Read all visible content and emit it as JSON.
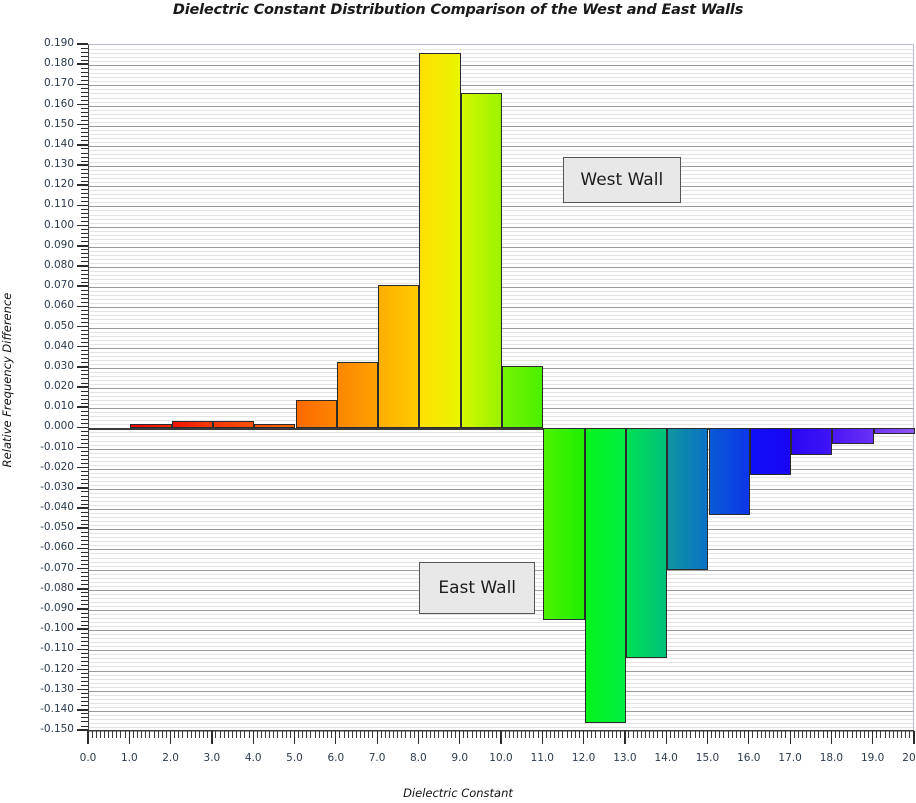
{
  "chart_data": {
    "type": "bar",
    "title": "Dielectric Constant Distribution Comparison of the West and East Walls",
    "xlabel": "Dielectric Constant",
    "ylabel": "Relative Frequency Difference",
    "xlim": [
      0.0,
      20.0
    ],
    "ylim": [
      -0.15,
      0.19
    ],
    "grid": true,
    "legend_position": "inside-annotations",
    "x_tick_labels": [
      "0.0",
      "1.0",
      "2.0",
      "3.0",
      "4.0",
      "5.0",
      "6.0",
      "7.0",
      "8.0",
      "9.0",
      "10.0",
      "11.0",
      "12.0",
      "13.0",
      "14.0",
      "15.0",
      "16.0",
      "17.0",
      "18.0",
      "19.0",
      "20.0"
    ],
    "x_tick_values": [
      0,
      1,
      2,
      3,
      4,
      5,
      6,
      7,
      8,
      9,
      10,
      11,
      12,
      13,
      14,
      15,
      16,
      17,
      18,
      19,
      20
    ],
    "y_tick_labels": [
      "0.190",
      "0.180",
      "0.170",
      "0.160",
      "0.150",
      "0.140",
      "0.130",
      "0.120",
      "0.110",
      "0.100",
      "0.090",
      "0.080",
      "0.070",
      "0.060",
      "0.050",
      "0.040",
      "0.030",
      "0.020",
      "0.010",
      "0.000",
      "-0.010",
      "-0.020",
      "-0.030",
      "-0.040",
      "-0.050",
      "-0.060",
      "-0.070",
      "-0.080",
      "-0.090",
      "-0.100",
      "-0.110",
      "-0.120",
      "-0.130",
      "-0.140",
      "-0.150"
    ],
    "y_tick_values": [
      0.19,
      0.18,
      0.17,
      0.16,
      0.15,
      0.14,
      0.13,
      0.12,
      0.11,
      0.1,
      0.09,
      0.08,
      0.07,
      0.06,
      0.05,
      0.04,
      0.03,
      0.02,
      0.01,
      0.0,
      -0.01,
      -0.02,
      -0.03,
      -0.04,
      -0.05,
      -0.06,
      -0.07,
      -0.08,
      -0.09,
      -0.1,
      -0.11,
      -0.12,
      -0.13,
      -0.14,
      -0.15
    ],
    "annotations": [
      {
        "text": "West Wall",
        "x": 12.9,
        "y": 0.123
      },
      {
        "text": "East Wall",
        "x": 9.4,
        "y": -0.079
      }
    ],
    "bins": [
      {
        "x0": 1,
        "x1": 2,
        "value": 0.002,
        "color": "#f11800"
      },
      {
        "x0": 2,
        "x1": 3,
        "value": 0.0035,
        "color": "#f52400"
      },
      {
        "x0": 3,
        "x1": 4,
        "value": 0.0035,
        "color": "#f74200"
      },
      {
        "x0": 4,
        "x1": 5,
        "value": 0.002,
        "color": "#fa5d00"
      },
      {
        "x0": 5,
        "x1": 6,
        "value": 0.014,
        "color": "#fc7400"
      },
      {
        "x0": 6,
        "x1": 7,
        "value": 0.033,
        "color": "#fd9000"
      },
      {
        "x0": 7,
        "x1": 8,
        "value": 0.071,
        "color": "#febe00"
      },
      {
        "x0": 8,
        "x1": 9,
        "value": 0.186,
        "color": "#f6ec00"
      },
      {
        "x0": 9,
        "x1": 10,
        "value": 0.166,
        "color": "#b6f400"
      },
      {
        "x0": 10,
        "x1": 11,
        "value": 0.031,
        "color": "#5cf200"
      },
      {
        "x0": 11,
        "x1": 12,
        "value": -0.095,
        "color": "#35f000"
      },
      {
        "x0": 12,
        "x1": 13,
        "value": -0.146,
        "color": "#00f22b"
      },
      {
        "x0": 13,
        "x1": 14,
        "value": -0.114,
        "color": "#00cf68"
      },
      {
        "x0": 14,
        "x1": 15,
        "value": -0.07,
        "color": "#0c8ca6"
      },
      {
        "x0": 15,
        "x1": 16,
        "value": -0.043,
        "color": "#0b4edc"
      },
      {
        "x0": 16,
        "x1": 17,
        "value": -0.023,
        "color": "#1107f4"
      },
      {
        "x0": 17,
        "x1": 18,
        "value": -0.013,
        "color": "#3409f5"
      },
      {
        "x0": 18,
        "x1": 19,
        "value": -0.008,
        "color": "#5a22f6"
      },
      {
        "x0": 19,
        "x1": 20,
        "value": -0.003,
        "color": "#7c3ef7"
      }
    ],
    "bar_gradients": [
      [
        "#f50000",
        "#f02b00"
      ],
      [
        "#f31100",
        "#f43d00"
      ],
      [
        "#f53600",
        "#f85100"
      ],
      [
        "#f95200",
        "#fb6800"
      ],
      [
        "#fb6a00",
        "#fd8400"
      ],
      [
        "#fc8600",
        "#fea000"
      ],
      [
        "#fdae00",
        "#ffcc00"
      ],
      [
        "#ffe000",
        "#e9f500"
      ],
      [
        "#d4f700",
        "#9bf300"
      ],
      [
        "#76f400",
        "#4bf000"
      ],
      [
        "#4df200",
        "#1ef000"
      ],
      [
        "#06f41c",
        "#00ef42"
      ],
      [
        "#00e054",
        "#00c07a"
      ],
      [
        "#0e96a0",
        "#0a71c6"
      ],
      [
        "#0a5ad6",
        "#0c36e9"
      ],
      [
        "#1010f6",
        "#1805f3"
      ],
      [
        "#2a08f4",
        "#4014f6"
      ],
      [
        "#4c18f6",
        "#6830f7"
      ],
      [
        "#7038f7",
        "#8d54f8"
      ]
    ]
  },
  "colors": {
    "grid_minor": "#e4e4e4",
    "grid_major": "#9a9a9a",
    "axis": "#3a3a3a",
    "tick_label": "#2a3b4d",
    "callout_bg": "#e8e8e8",
    "callout_border": "#555555"
  }
}
